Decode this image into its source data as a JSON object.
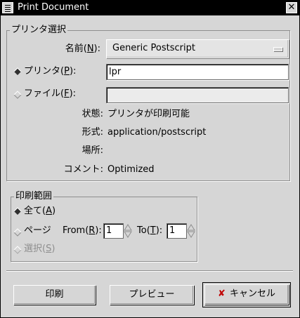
{
  "window": {
    "title": "Print Document",
    "close_glyph": "✕",
    "menu_icon": "window-menu-icon"
  },
  "printer_frame": {
    "title": "プリンタ選択",
    "name_label": "名前",
    "name_mnemonic": "N",
    "name_value": "Generic Postscript",
    "printer_radio_label": "プリンタ",
    "printer_radio_mnemonic": "P",
    "printer_command": "lpr",
    "file_radio_label": "ファイル",
    "file_radio_mnemonic": "F",
    "file_value": "",
    "state_label": "状態:",
    "state_value": "プリンタが印刷可能",
    "type_label": "形式:",
    "type_value": "application/postscript",
    "location_label": "場所:",
    "location_value": "",
    "comment_label": "コメント:",
    "comment_value": "Optimized"
  },
  "range_frame": {
    "title": "印刷範囲",
    "all_label": "全て",
    "all_mnemonic": "A",
    "pages_label": "ページ",
    "from_label": "From",
    "from_mnemonic": "R",
    "from_value": "1",
    "to_label": "To",
    "to_mnemonic": "T",
    "to_value": "1",
    "selection_label": "選択",
    "selection_mnemonic": "S"
  },
  "buttons": {
    "print": "印刷",
    "preview": "プレビュー",
    "cancel": "キャンセル",
    "cancel_glyph": "✘"
  },
  "selected": {
    "destination": "printer",
    "range": "all"
  }
}
